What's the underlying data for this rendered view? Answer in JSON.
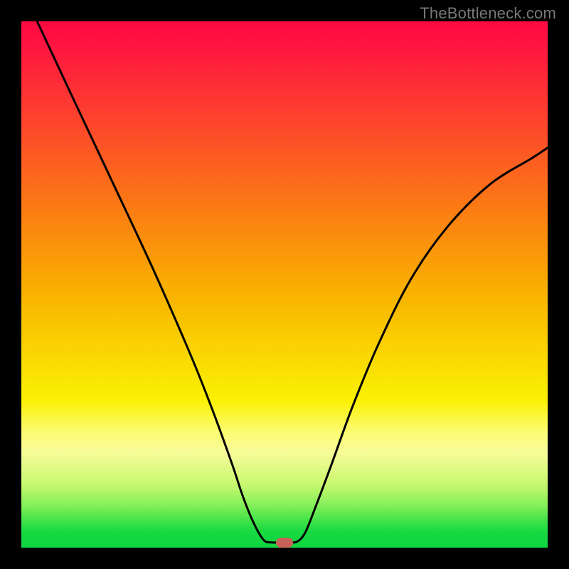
{
  "watermark": "TheBottleneck.com",
  "chart_data": {
    "type": "line",
    "title": "",
    "xlabel": "",
    "ylabel": "",
    "xlim": [
      0,
      100
    ],
    "ylim": [
      0,
      100
    ],
    "series": [
      {
        "name": "curve",
        "x": [
          3,
          10,
          18,
          25,
          32,
          36,
          40,
          42,
          44,
          46,
          47.5,
          49,
          51,
          52.5,
          54,
          56,
          59,
          63,
          68,
          74,
          81,
          89,
          97,
          100
        ],
        "values": [
          100,
          85,
          68,
          53,
          37,
          27,
          16,
          10,
          5,
          1.5,
          1,
          1,
          1,
          1.2,
          3,
          8,
          16,
          27,
          39,
          51,
          61,
          69,
          74,
          76
        ]
      }
    ],
    "marker": {
      "x": 50,
      "y": 1
    },
    "gradient_stops": [
      {
        "pos": 0,
        "color": "#FE0943"
      },
      {
        "pos": 18,
        "color": "#FD412E"
      },
      {
        "pos": 36,
        "color": "#FB7D13"
      },
      {
        "pos": 52,
        "color": "#F9B300"
      },
      {
        "pos": 72,
        "color": "#FBF104"
      },
      {
        "pos": 88,
        "color": "#C8F86F"
      },
      {
        "pos": 100,
        "color": "#0FD740"
      }
    ]
  }
}
